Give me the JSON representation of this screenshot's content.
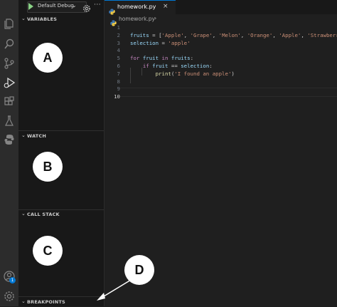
{
  "debug_toolbar": {
    "config_label": "Default Debug",
    "start_icon": "play-icon",
    "dropdown_icon": "chevron-down-icon",
    "settings_icon": "gear-icon",
    "more_label": "···"
  },
  "activity_bar": {
    "items": [
      "files-icon",
      "search-icon",
      "source-control-icon",
      "run-debug-icon",
      "extensions-icon",
      "testing-icon",
      "python-icon"
    ],
    "bottom": [
      "account-icon",
      "manage-gear-icon"
    ],
    "account_badge": "1"
  },
  "sections": [
    {
      "title": "VARIABLES",
      "callout": "A"
    },
    {
      "title": "WATCH",
      "callout": "B"
    },
    {
      "title": "CALL STACK",
      "callout": "C"
    },
    {
      "title": "BREAKPOINTS",
      "callout": "D"
    }
  ],
  "editor": {
    "tab_label": "homework.py",
    "tab_close": "×",
    "breadcrumb_file": "homework.py",
    "breadcrumb_sep": "›",
    "line_numbers": [
      "1",
      "2",
      "3",
      "4",
      "5",
      "6",
      "7",
      "8",
      "9",
      "10"
    ],
    "code": [
      "",
      "fruits = ['Apple', 'Grape', 'Melon', 'Orange', 'Apple', 'Strawberry']",
      "selection = 'apple'",
      "",
      "for fruit in fruits:",
      "    if fruit == selection:",
      "        print('I found an apple')",
      "",
      "",
      ""
    ]
  },
  "colors": {
    "accent": "#0078d4",
    "start_green": "#89d185",
    "keyword": "#c586c0",
    "string": "#ce9178",
    "variable": "#9cdcfe",
    "function": "#dcdcaa"
  }
}
